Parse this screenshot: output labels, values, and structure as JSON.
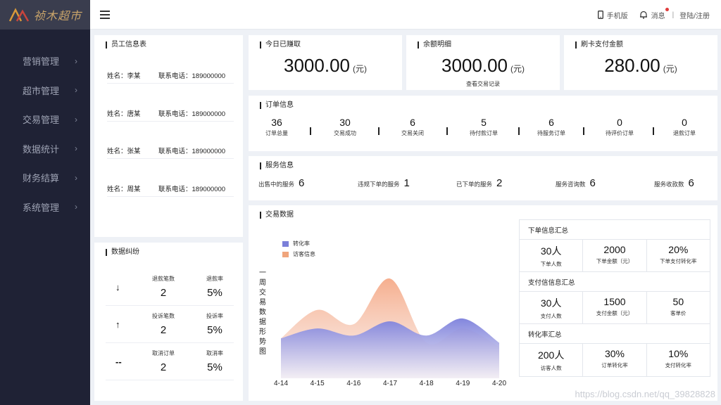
{
  "logo": {
    "text": "祯木超市"
  },
  "sidebar": {
    "items": [
      {
        "label": "营销管理"
      },
      {
        "label": "超市管理"
      },
      {
        "label": "交易管理"
      },
      {
        "label": "数据统计"
      },
      {
        "label": "财务结算"
      },
      {
        "label": "系统管理"
      }
    ]
  },
  "header": {
    "mobile_label": "手机版",
    "messages_label": "消息",
    "separator": "|",
    "login_label": "登陆/注册"
  },
  "employees": {
    "title": "员工信息表",
    "rows": [
      {
        "name": "姓名：李某",
        "phone": "联系电话：189000000"
      },
      {
        "name": "姓名：唐某",
        "phone": "联系电话：189000000"
      },
      {
        "name": "姓名：张某",
        "phone": "联系电话：189000000"
      },
      {
        "name": "姓名：周某",
        "phone": "联系电话：189000000"
      }
    ]
  },
  "stats": {
    "today": {
      "title": "今日已赚取",
      "value": "3000.00",
      "unit": "(元)"
    },
    "balance": {
      "title": "余额明细",
      "value": "3000.00",
      "unit": "(元)",
      "link": "查看交易记录"
    },
    "card": {
      "title": "刷卡支付金额",
      "value": "280.00",
      "unit": "(元)"
    }
  },
  "orders": {
    "title": "订单信息",
    "items": [
      {
        "value": "36",
        "label": "订单总量"
      },
      {
        "value": "30",
        "label": "交易成功"
      },
      {
        "value": "6",
        "label": "交易关闭"
      },
      {
        "value": "5",
        "label": "待付款订单"
      },
      {
        "value": "6",
        "label": "待服务订单"
      },
      {
        "value": "0",
        "label": "待评价订单"
      },
      {
        "value": "0",
        "label": "退款订单"
      }
    ]
  },
  "services": {
    "title": "服务信息",
    "items": [
      {
        "label": "出售中的服务",
        "value": "6"
      },
      {
        "label": "违规下单的服务",
        "value": "1"
      },
      {
        "label": "已下单的服务",
        "value": "2"
      },
      {
        "label": "服务咨询数",
        "value": "6"
      },
      {
        "label": "服务收款数",
        "value": "6"
      }
    ]
  },
  "trade": {
    "title": "交易数据",
    "vertical_label": "一周交易数据形势图"
  },
  "chart_data": {
    "type": "area",
    "categories": [
      "4-14",
      "4-15",
      "4-16",
      "4-17",
      "4-18",
      "4-19",
      "4-20"
    ],
    "series": [
      {
        "name": "转化率",
        "color": "#7b7fd9",
        "values": [
          28,
          35,
          30,
          40,
          30,
          42,
          25
        ]
      },
      {
        "name": "访客信息",
        "color": "#f0a57c",
        "values": [
          28,
          48,
          38,
          70,
          25,
          35,
          22
        ]
      }
    ],
    "ylim": [
      0,
      80
    ],
    "legend": "top-left",
    "grid": false
  },
  "summary": {
    "sections": [
      {
        "title": "下单信息汇总",
        "cells": [
          {
            "value": "30人",
            "label": "下单人数"
          },
          {
            "value": "2000",
            "label": "下单金额（元）"
          },
          {
            "value": "20%",
            "label": "下单支付转化率"
          }
        ]
      },
      {
        "title": "支付信信息汇总",
        "cells": [
          {
            "value": "30人",
            "label": "支付人数"
          },
          {
            "value": "1500",
            "label": "支付金额（元）"
          },
          {
            "value": "50",
            "label": "客单价"
          }
        ]
      },
      {
        "title": "转化率汇总",
        "cells": [
          {
            "value": "200人",
            "label": "访客人数"
          },
          {
            "value": "30%",
            "label": "订单转化率"
          },
          {
            "value": "10%",
            "label": "支付转化率"
          }
        ]
      }
    ]
  },
  "disputes": {
    "title": "数据纠纷",
    "rows": [
      {
        "arrow": "↓",
        "count_label": "退款笔数",
        "count": "2",
        "rate_label": "退款率",
        "rate": "5%"
      },
      {
        "arrow": "↑",
        "count_label": "投诉笔数",
        "count": "2",
        "rate_label": "投诉率",
        "rate": "5%"
      },
      {
        "arrow": "--",
        "count_label": "取消订单",
        "count": "2",
        "rate_label": "取消率",
        "rate": "5%"
      }
    ]
  },
  "watermark": "https://blog.csdn.net/qq_39828828"
}
